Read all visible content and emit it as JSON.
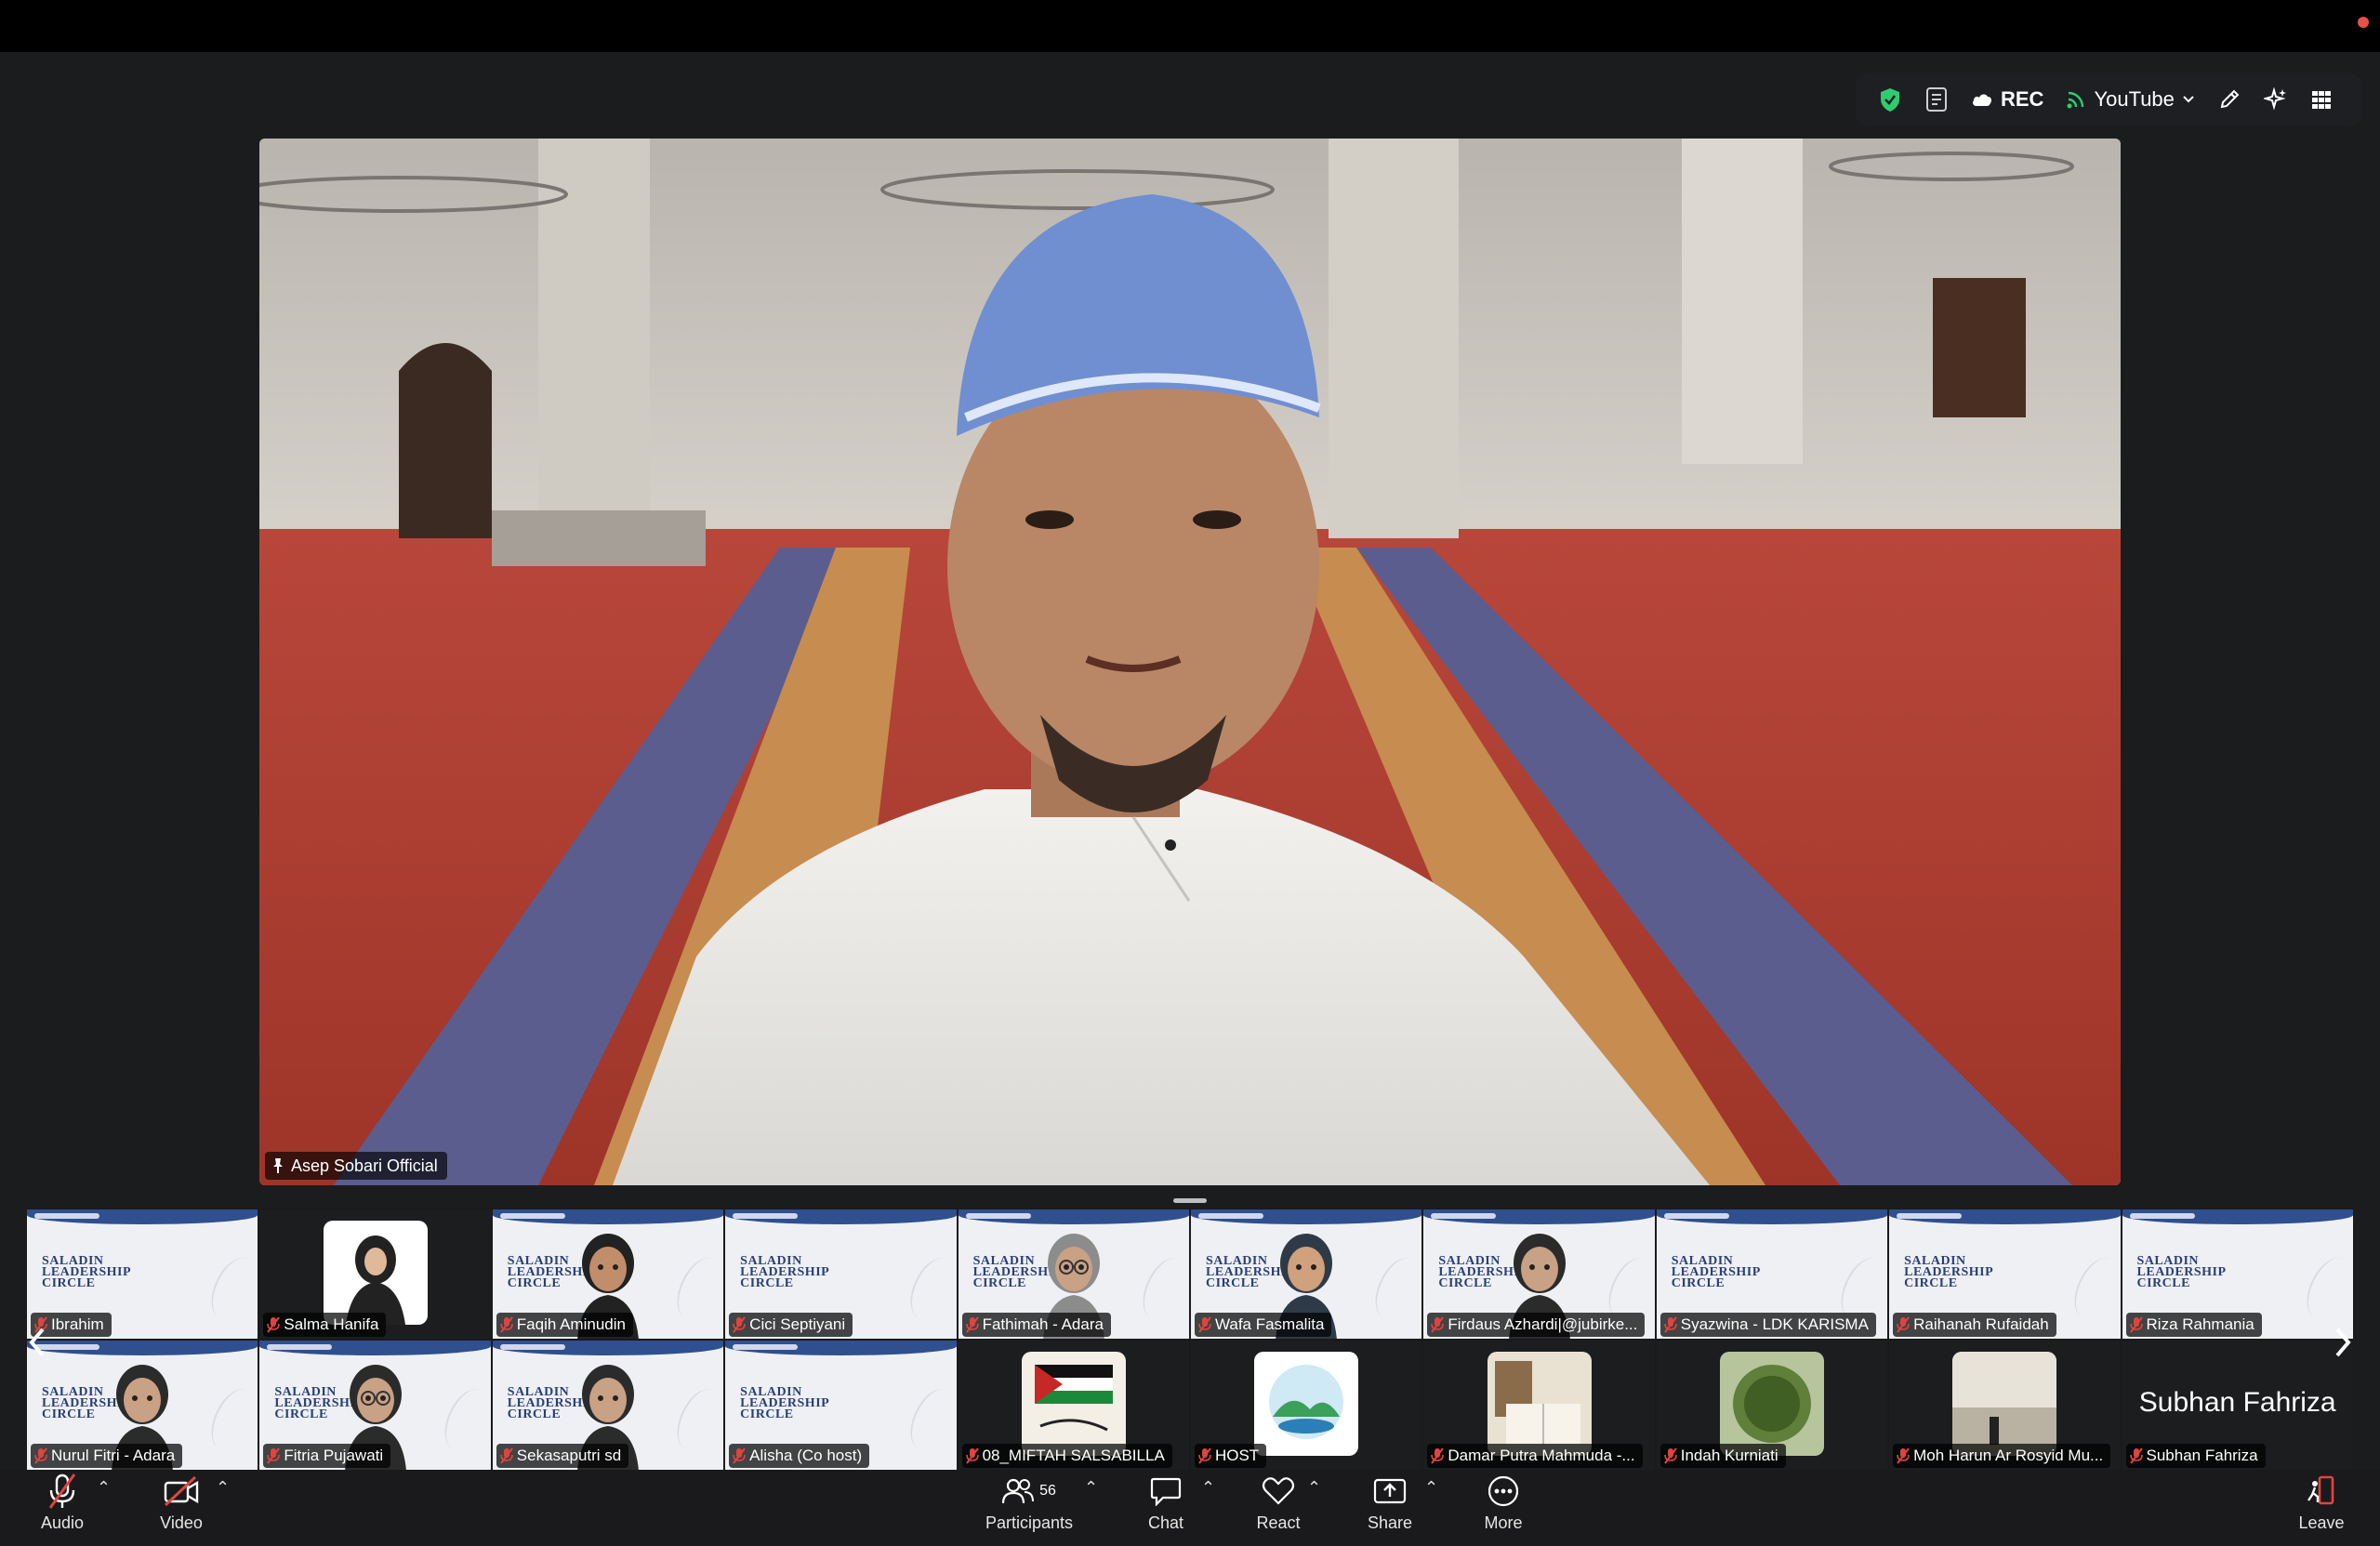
{
  "toolbar": {
    "rec_label": "REC",
    "stream_label": "YouTube"
  },
  "main_video": {
    "speaker_name": "Asep Sobari Official"
  },
  "gallery": {
    "tiles": [
      {
        "name": "Ibrahim",
        "style": "brand"
      },
      {
        "name": "Salma Hanifa",
        "style": "dark-photo"
      },
      {
        "name": "Faqih Aminudin",
        "style": "brand-avatar"
      },
      {
        "name": "Cici Septiyani",
        "style": "brand"
      },
      {
        "name": "Fathimah - Adara",
        "style": "brand-person"
      },
      {
        "name": "Wafa Fasmalita",
        "style": "brand-avatar"
      },
      {
        "name": "Firdaus Azhardi|@jubirke...",
        "style": "brand-person"
      },
      {
        "name": "Syazwina - LDK KARISMA",
        "style": "brand"
      },
      {
        "name": "Raihanah Rufaidah",
        "style": "brand"
      },
      {
        "name": "Riza Rahmania",
        "style": "brand"
      },
      {
        "name": "Nurul Fitri - Adara",
        "style": "brand-person"
      },
      {
        "name": "Fitria Pujawati",
        "style": "brand-person"
      },
      {
        "name": "Sekasaputri sd",
        "style": "brand-person"
      },
      {
        "name": "Alisha (Co host)",
        "style": "brand"
      },
      {
        "name": "08_MIFTAH SALSABILLA",
        "style": "dark-photo"
      },
      {
        "name": "HOST",
        "style": "dark-photo"
      },
      {
        "name": "Damar Putra Mahmuda -...",
        "style": "dark-photo"
      },
      {
        "name": "Indah Kurniati",
        "style": "dark-photo"
      },
      {
        "name": "Moh Harun Ar Rosyid Mu...",
        "style": "dark-photo"
      },
      {
        "name": "Subhan Fahriza",
        "style": "dark-name",
        "display_name": "Subhan Fahriza"
      }
    ],
    "brand_logo_lines": [
      "SALADIN",
      "LEADERSHIP",
      "CIRCLE"
    ]
  },
  "controls": {
    "audio_label": "Audio",
    "video_label": "Video",
    "participants_label": "Participants",
    "participants_count": "56",
    "chat_label": "Chat",
    "react_label": "React",
    "share_label": "Share",
    "more_label": "More",
    "leave_label": "Leave"
  },
  "colors": {
    "accent_green": "#2ecc71",
    "mic_off_red": "#e0443e",
    "leave_red": "#e0443e"
  }
}
